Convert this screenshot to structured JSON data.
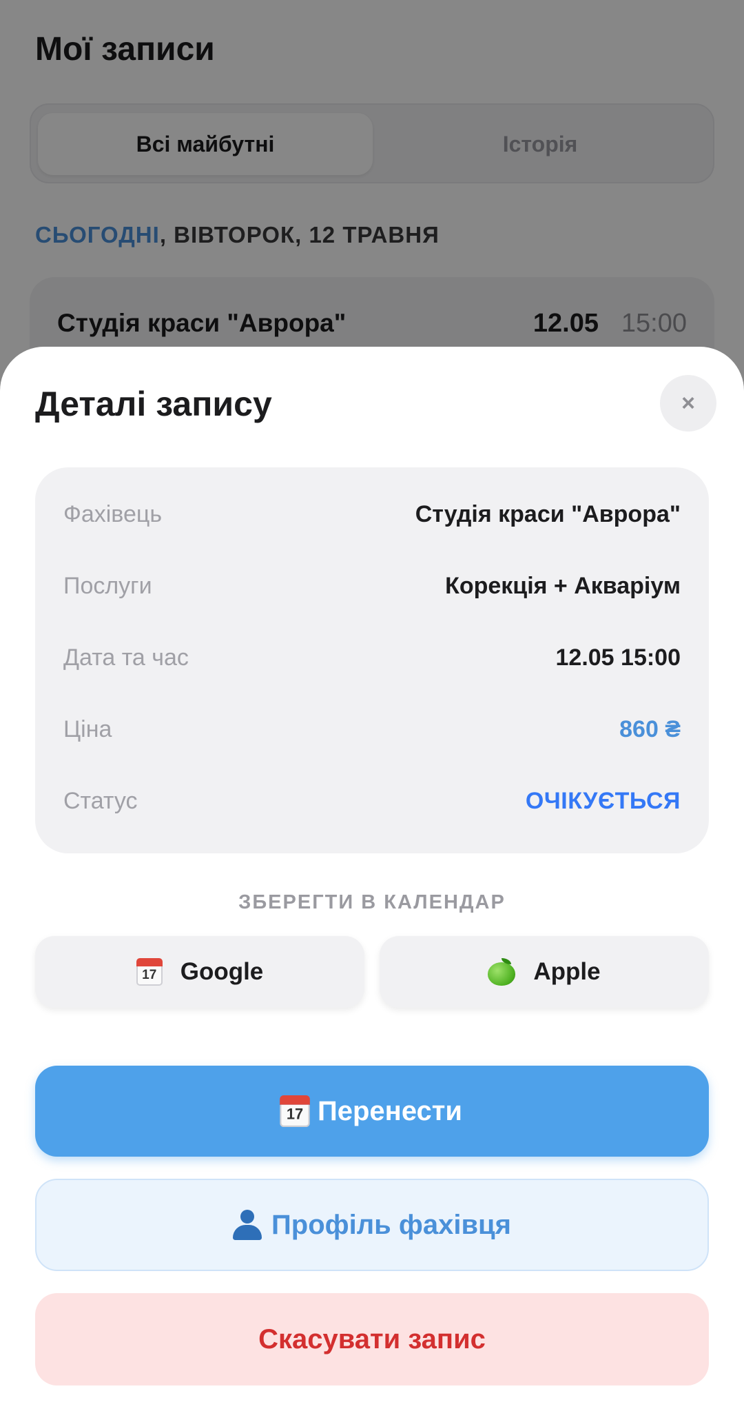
{
  "background": {
    "title": "Мої записи",
    "tabs": [
      {
        "label": "Всі майбутні",
        "active": true
      },
      {
        "label": "Історія",
        "active": false
      }
    ],
    "day_header": {
      "today": "СЬОГОДНІ",
      "rest": ", ВІВТОРОК, 12 ТРАВНЯ"
    },
    "appointment": {
      "name": "Студія краси \"Аврора\"",
      "date": "12.05",
      "time": "15:00"
    }
  },
  "sheet": {
    "title": "Деталі запису",
    "close_icon": "×",
    "details": [
      {
        "label": "Фахівець",
        "value": "Студія краси \"Аврора\""
      },
      {
        "label": "Послуги",
        "value": "Корекція + Акваріум"
      },
      {
        "label": "Дата та час",
        "value": "12.05 15:00"
      },
      {
        "label": "Ціна",
        "value": "860 ₴"
      },
      {
        "label": "Статус",
        "value": "ОЧІКУЄТЬСЯ"
      }
    ],
    "calendar_label": "ЗБЕРЕГТИ В КАЛЕНДАР",
    "calendar_buttons": {
      "google": {
        "label": "Google",
        "icon": "calendar-icon",
        "icon_day": "17"
      },
      "apple": {
        "label": "Apple",
        "icon": "green-apple-icon"
      }
    },
    "reschedule": {
      "label": "Перенести",
      "icon": "calendar-icon",
      "icon_day": "17"
    },
    "profile": {
      "label": "Профіль фахівця",
      "icon": "person-icon"
    },
    "cancel": {
      "label": "Скасувати запис"
    }
  },
  "colors": {
    "accent": "#4ea1ea",
    "status": "#3478f6",
    "danger": "#d32f2f",
    "danger_bg": "#fde2e2",
    "overlay": "rgba(0,0,0,0.47)"
  }
}
